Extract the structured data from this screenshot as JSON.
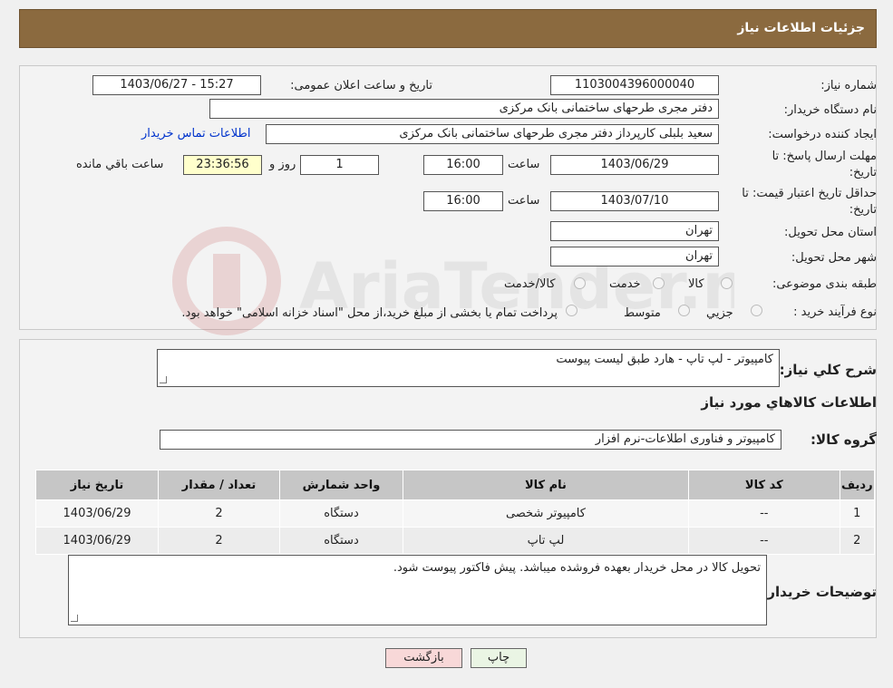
{
  "header": {
    "title": "جزئیات اطلاعات نیاز"
  },
  "form": {
    "need_number_label": "شماره نیاز:",
    "need_number": "1103004396000040",
    "announce_label": "تاریخ و ساعت اعلان عمومی:",
    "announce_value": "1403/06/27 - 15:27",
    "buyer_label": "نام دستگاه خریدار:",
    "buyer_value": "دفتر مجری طرحهای ساختمانی بانک مرکزی",
    "creator_label": "ایجاد کننده درخواست:",
    "creator_value": "سعید بلبلی کارپرداز دفتر مجری طرحهای ساختمانی بانک مرکزی",
    "contact_link": "اطلاعات تماس خریدار",
    "deadline_label_1": "مهلت ارسال پاسخ: تا",
    "deadline_label_2": "تاریخ:",
    "deadline_date": "1403/06/29",
    "time_label": "ساعت",
    "deadline_time": "16:00",
    "days_value": "1",
    "days_label": "روز و",
    "remaining_time": "23:36:56",
    "remaining_label": "ساعت باقي مانده",
    "validity_label_1": "حداقل تاریخ اعتبار قیمت: تا",
    "validity_label_2": "تاریخ:",
    "validity_date": "1403/07/10",
    "validity_time": "16:00",
    "province_label": "استان محل تحویل:",
    "province_value": "تهران",
    "city_label": "شهر محل تحویل:",
    "city_value": "تهران",
    "category_label": "طبقه بندی موضوعی:",
    "category_options": [
      "کالا",
      "خدمت",
      "کالا/خدمت"
    ],
    "process_label": "نوع فرآیند خرید :",
    "process_options": [
      "جزیي",
      "متوسط"
    ],
    "process_note": "پرداخت تمام یا بخشی از مبلغ خرید،از محل \"اسناد خزانه اسلامی\" خواهد بود."
  },
  "details": {
    "desc_label": "شرح کلي نیاز:",
    "desc_value": "کامپیوتر - لپ تاپ - هارد طبق لیست پیوست",
    "goods_title": "اطلاعات کالاهاي مورد نیاز",
    "group_label": "گروه کالا:",
    "group_value": "کامپیوتر و فناوری اطلاعات-نرم افزار",
    "table": {
      "headers": [
        "ردیف",
        "کد کالا",
        "نام کالا",
        "واحد شمارش",
        "تعداد / مقدار",
        "تاریخ نیاز"
      ],
      "rows": [
        [
          "1",
          "--",
          "کامپیوتر شخصی",
          "دستگاه",
          "2",
          "1403/06/29"
        ],
        [
          "2",
          "--",
          "لپ تاپ",
          "دستگاه",
          "2",
          "1403/06/29"
        ]
      ]
    },
    "buyer_notes_label": "توضیحات خریدار:",
    "buyer_notes": "تحویل کالا در محل خریدار بعهده فروشده میباشد. پیش فاکتور پیوست شود."
  },
  "buttons": {
    "print": "چاپ",
    "back": "بازگشت"
  },
  "colors": {
    "header_bg": "#8b6a3f",
    "back_button_bg": "#f8d8d8",
    "print_button_bg": "#eaf5e4"
  }
}
